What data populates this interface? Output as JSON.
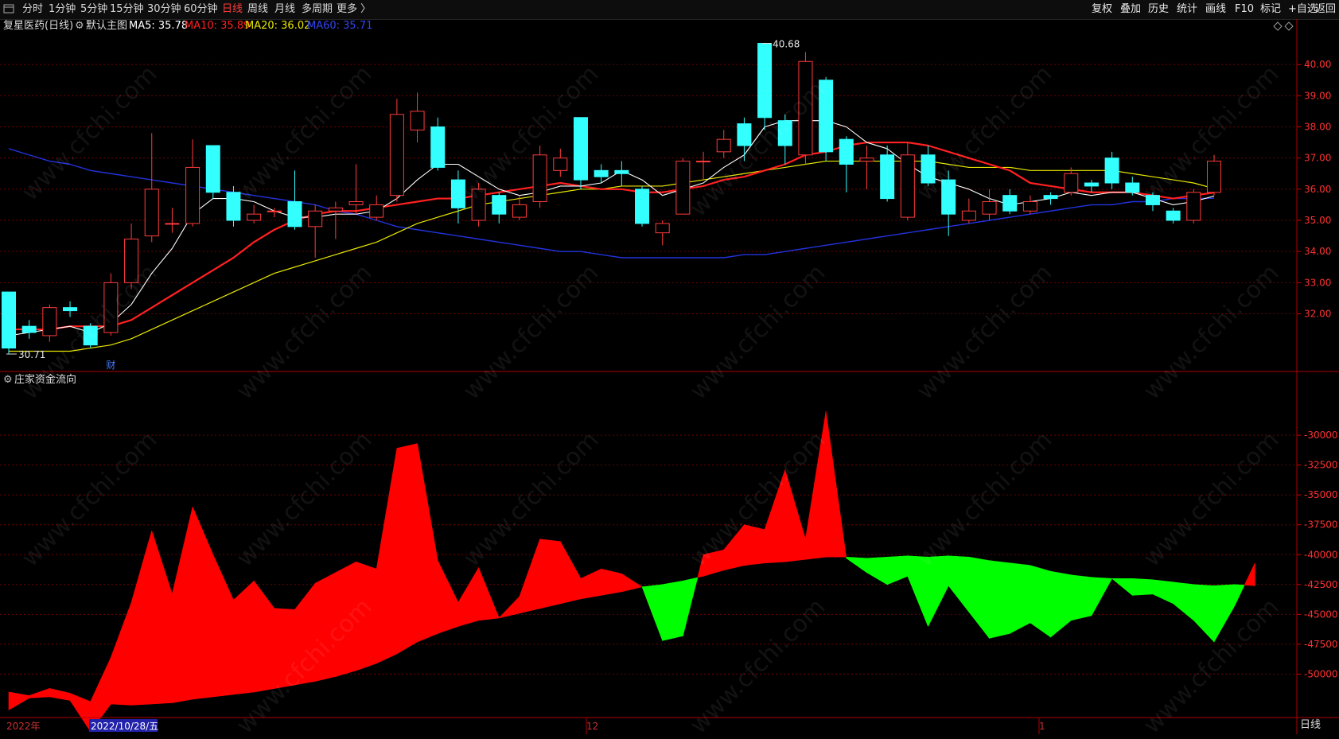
{
  "toolbar": {
    "periods": [
      "分时",
      "1分钟",
      "5分钟",
      "15分钟",
      "30分钟",
      "60分钟",
      "日线",
      "周线",
      "月线",
      "多周期",
      "更多 〉"
    ],
    "active_period": "日线",
    "right_buttons": [
      "复权",
      "叠加",
      "历史",
      "统计",
      "画线",
      "F10",
      "标记",
      "+自选",
      "返回"
    ]
  },
  "info": {
    "stock": "复星医药(日线)",
    "main_chart": "默认主图",
    "ma5": "MA5: 35.78",
    "ma10": "MA10: 35.89",
    "ma20": "MA20: 36.02",
    "ma60": "MA60: 35.71"
  },
  "colors": {
    "up": "#ff3b3b",
    "down": "#33ffff",
    "ma5": "#ffffff",
    "ma10": "#ff2020",
    "ma20": "#e8e800",
    "ma60": "#2233dd",
    "flow_up": "#ff0000",
    "flow_down": "#00ff00",
    "grid": "#6e0000",
    "axis_text": "#ff3030"
  },
  "indicator": {
    "title": "庄家资金流向"
  },
  "annotations": {
    "high": "40.68",
    "low": "30.71",
    "finance_marker": "财"
  },
  "x_labels": {
    "start": "2022年",
    "selected": "2022/10/28/五",
    "dec": "12",
    "jan": "1"
  },
  "period_tag": "日线",
  "chart_data": {
    "type": "candlestick",
    "price_axis": {
      "ticks": [
        32,
        33,
        34,
        35,
        36,
        37,
        38,
        39,
        40
      ],
      "labels": [
        "32.00",
        "33.00",
        "34.00",
        "35.00",
        "36.00",
        "37.00",
        "38.00",
        "39.00",
        "40.00"
      ],
      "range": [
        30.2,
        41.0
      ]
    },
    "flow_axis": {
      "ticks": [
        -30000,
        -32500,
        -35000,
        -37500,
        -40000,
        -42500,
        -45000,
        -47500,
        -50000
      ],
      "labels": [
        "-30000",
        "-32500",
        "-35000",
        "-37500",
        "-40000",
        "-42500",
        "-45000",
        "-47500",
        "-50000"
      ],
      "range": [
        -53500,
        -26000
      ]
    },
    "candles": [
      {
        "o": 32.7,
        "c": 30.9,
        "h": 32.7,
        "l": 30.71
      },
      {
        "o": 31.6,
        "c": 31.4,
        "h": 31.8,
        "l": 31.2
      },
      {
        "o": 31.3,
        "c": 32.2,
        "h": 32.3,
        "l": 31.1
      },
      {
        "o": 32.2,
        "c": 32.1,
        "h": 32.4,
        "l": 31.9
      },
      {
        "o": 31.6,
        "c": 31.0,
        "h": 31.7,
        "l": 30.9
      },
      {
        "o": 31.4,
        "c": 33.0,
        "h": 33.3,
        "l": 31.3
      },
      {
        "o": 33.0,
        "c": 34.4,
        "h": 34.9,
        "l": 32.8
      },
      {
        "o": 34.5,
        "c": 36.0,
        "h": 37.8,
        "l": 34.3
      },
      {
        "o": 34.9,
        "c": 34.9,
        "h": 35.4,
        "l": 34.6
      },
      {
        "o": 34.9,
        "c": 36.7,
        "h": 37.6,
        "l": 34.8
      },
      {
        "o": 37.4,
        "c": 35.9,
        "h": 37.4,
        "l": 35.7
      },
      {
        "o": 35.9,
        "c": 35.0,
        "h": 36.1,
        "l": 34.8
      },
      {
        "o": 35.0,
        "c": 35.2,
        "h": 35.5,
        "l": 34.9
      },
      {
        "o": 35.3,
        "c": 35.3,
        "h": 35.4,
        "l": 35.1
      },
      {
        "o": 35.6,
        "c": 34.8,
        "h": 36.6,
        "l": 34.7
      },
      {
        "o": 34.8,
        "c": 35.3,
        "h": 35.5,
        "l": 33.8
      },
      {
        "o": 35.3,
        "c": 35.4,
        "h": 35.6,
        "l": 34.4
      },
      {
        "o": 35.5,
        "c": 35.6,
        "h": 36.8,
        "l": 35.2
      },
      {
        "o": 35.1,
        "c": 35.5,
        "h": 35.8,
        "l": 35.0
      },
      {
        "o": 35.8,
        "c": 38.4,
        "h": 38.9,
        "l": 35.6
      },
      {
        "o": 37.9,
        "c": 38.5,
        "h": 39.1,
        "l": 37.5
      },
      {
        "o": 38.0,
        "c": 36.7,
        "h": 38.3,
        "l": 36.6
      },
      {
        "o": 36.3,
        "c": 35.4,
        "h": 36.6,
        "l": 34.9
      },
      {
        "o": 35.0,
        "c": 36.0,
        "h": 36.2,
        "l": 34.8
      },
      {
        "o": 35.8,
        "c": 35.2,
        "h": 35.9,
        "l": 34.9
      },
      {
        "o": 35.1,
        "c": 35.5,
        "h": 35.8,
        "l": 35.0
      },
      {
        "o": 35.6,
        "c": 37.1,
        "h": 37.4,
        "l": 35.4
      },
      {
        "o": 36.6,
        "c": 37.0,
        "h": 37.3,
        "l": 36.4
      },
      {
        "o": 38.3,
        "c": 36.3,
        "h": 38.3,
        "l": 36.0
      },
      {
        "o": 36.6,
        "c": 36.4,
        "h": 36.8,
        "l": 36.2
      },
      {
        "o": 36.6,
        "c": 36.5,
        "h": 36.9,
        "l": 36.1
      },
      {
        "o": 36.0,
        "c": 34.9,
        "h": 36.1,
        "l": 34.8
      },
      {
        "o": 34.6,
        "c": 34.9,
        "h": 35.0,
        "l": 34.2
      },
      {
        "o": 35.2,
        "c": 36.9,
        "h": 37.0,
        "l": 35.2
      },
      {
        "o": 36.9,
        "c": 36.9,
        "h": 37.2,
        "l": 36.3
      },
      {
        "o": 37.2,
        "c": 37.6,
        "h": 37.9,
        "l": 37.0
      },
      {
        "o": 38.1,
        "c": 37.4,
        "h": 38.3,
        "l": 36.9
      },
      {
        "o": 40.68,
        "c": 38.3,
        "h": 40.68,
        "l": 37.9
      },
      {
        "o": 38.2,
        "c": 37.4,
        "h": 38.4,
        "l": 36.8
      },
      {
        "o": 37.1,
        "c": 40.1,
        "h": 40.4,
        "l": 36.8
      },
      {
        "o": 39.5,
        "c": 37.2,
        "h": 39.6,
        "l": 36.9
      },
      {
        "o": 37.6,
        "c": 36.8,
        "h": 37.7,
        "l": 35.9
      },
      {
        "o": 36.9,
        "c": 37.0,
        "h": 37.4,
        "l": 36.0
      },
      {
        "o": 37.1,
        "c": 35.7,
        "h": 37.4,
        "l": 35.6
      },
      {
        "o": 35.1,
        "c": 37.1,
        "h": 37.5,
        "l": 35.0
      },
      {
        "o": 37.1,
        "c": 36.2,
        "h": 37.4,
        "l": 36.1
      },
      {
        "o": 36.3,
        "c": 35.2,
        "h": 36.6,
        "l": 34.5
      },
      {
        "o": 35.0,
        "c": 35.3,
        "h": 35.7,
        "l": 34.9
      },
      {
        "o": 35.2,
        "c": 35.6,
        "h": 36.0,
        "l": 35.0
      },
      {
        "o": 35.8,
        "c": 35.3,
        "h": 36.0,
        "l": 35.2
      },
      {
        "o": 35.3,
        "c": 35.6,
        "h": 35.8,
        "l": 35.2
      },
      {
        "o": 35.8,
        "c": 35.7,
        "h": 35.9,
        "l": 35.5
      },
      {
        "o": 35.9,
        "c": 36.5,
        "h": 36.7,
        "l": 35.8
      },
      {
        "o": 36.2,
        "c": 36.1,
        "h": 36.3,
        "l": 35.9
      },
      {
        "o": 37.0,
        "c": 36.2,
        "h": 37.2,
        "l": 36.0
      },
      {
        "o": 36.2,
        "c": 35.9,
        "h": 36.4,
        "l": 35.8
      },
      {
        "o": 35.8,
        "c": 35.5,
        "h": 35.9,
        "l": 35.3
      },
      {
        "o": 35.3,
        "c": 35.0,
        "h": 35.4,
        "l": 34.9
      },
      {
        "o": 35.0,
        "c": 35.9,
        "h": 36.0,
        "l": 34.9
      },
      {
        "o": 35.9,
        "c": 36.9,
        "h": 37.1,
        "l": 35.8
      }
    ],
    "ma5": [
      31.3,
      31.4,
      31.5,
      31.6,
      31.4,
      31.7,
      32.3,
      33.3,
      34.1,
      35.2,
      35.7,
      35.7,
      35.6,
      35.3,
      35.1,
      35.1,
      35.2,
      35.2,
      35.3,
      35.7,
      36.3,
      36.8,
      36.8,
      36.4,
      36.0,
      35.8,
      35.9,
      36.1,
      36.1,
      36.2,
      36.6,
      36.3,
      35.8,
      36.0,
      36.2,
      36.7,
      37.1,
      38.0,
      38.2,
      38.2,
      38.2,
      38.0,
      37.5,
      37.3,
      36.8,
      36.4,
      36.2,
      36.0,
      35.7,
      35.5,
      35.6,
      35.7,
      35.9,
      35.8,
      35.9,
      35.9,
      35.7,
      35.5,
      35.6,
      35.78
    ],
    "ma10": [
      31.5,
      31.5,
      31.5,
      31.6,
      31.6,
      31.6,
      31.8,
      32.2,
      32.6,
      33.0,
      33.4,
      33.8,
      34.3,
      34.7,
      35.0,
      35.2,
      35.3,
      35.3,
      35.4,
      35.5,
      35.6,
      35.7,
      35.7,
      35.8,
      35.9,
      36.0,
      36.1,
      36.2,
      36.1,
      36.0,
      36.0,
      35.9,
      35.9,
      36.0,
      36.1,
      36.3,
      36.4,
      36.6,
      36.8,
      37.1,
      37.2,
      37.4,
      37.5,
      37.5,
      37.5,
      37.4,
      37.2,
      37.0,
      36.8,
      36.6,
      36.2,
      36.1,
      36.0,
      35.9,
      35.9,
      35.9,
      35.8,
      35.7,
      35.8,
      35.89
    ],
    "ma20": [
      30.8,
      30.8,
      30.8,
      30.8,
      30.9,
      31.0,
      31.2,
      31.5,
      31.8,
      32.1,
      32.4,
      32.7,
      33.0,
      33.3,
      33.5,
      33.7,
      33.9,
      34.1,
      34.3,
      34.6,
      34.9,
      35.1,
      35.3,
      35.5,
      35.6,
      35.7,
      35.8,
      35.9,
      36.0,
      36.0,
      36.1,
      36.1,
      36.1,
      36.2,
      36.3,
      36.4,
      36.5,
      36.6,
      36.7,
      36.8,
      36.9,
      36.9,
      36.9,
      36.9,
      36.9,
      36.9,
      36.8,
      36.7,
      36.7,
      36.7,
      36.6,
      36.6,
      36.6,
      36.6,
      36.6,
      36.5,
      36.4,
      36.3,
      36.2,
      36.02
    ],
    "ma60": [
      37.3,
      37.1,
      36.9,
      36.8,
      36.6,
      36.5,
      36.4,
      36.3,
      36.2,
      36.1,
      36.0,
      35.9,
      35.8,
      35.7,
      35.6,
      35.5,
      35.3,
      35.2,
      35.0,
      34.8,
      34.7,
      34.6,
      34.5,
      34.4,
      34.3,
      34.2,
      34.1,
      34.0,
      34.0,
      33.9,
      33.8,
      33.8,
      33.8,
      33.8,
      33.8,
      33.8,
      33.9,
      33.9,
      34.0,
      34.1,
      34.2,
      34.3,
      34.4,
      34.5,
      34.6,
      34.7,
      34.8,
      34.9,
      35.0,
      35.1,
      35.2,
      35.3,
      35.4,
      35.5,
      35.5,
      35.6,
      35.6,
      35.7,
      35.7,
      35.71
    ],
    "flow": [
      {
        "line": -51500,
        "ref": -53000
      },
      {
        "line": -51800,
        "ref": -52000
      },
      {
        "line": -51200,
        "ref": -51900
      },
      {
        "line": -51600,
        "ref": -52200
      },
      {
        "line": -52300,
        "ref": -54800
      },
      {
        "line": -48600,
        "ref": -52500
      },
      {
        "line": -44000,
        "ref": -52600
      },
      {
        "line": -38000,
        "ref": -52500
      },
      {
        "line": -43300,
        "ref": -52400
      },
      {
        "line": -36000,
        "ref": -52100
      },
      {
        "line": -40000,
        "ref": -51900
      },
      {
        "line": -43800,
        "ref": -51700
      },
      {
        "line": -42200,
        "ref": -51500
      },
      {
        "line": -44500,
        "ref": -51200
      },
      {
        "line": -44600,
        "ref": -50900
      },
      {
        "line": -42400,
        "ref": -50600
      },
      {
        "line": -41500,
        "ref": -50200
      },
      {
        "line": -40600,
        "ref": -49700
      },
      {
        "line": -41200,
        "ref": -49100
      },
      {
        "line": -31100,
        "ref": -48300
      },
      {
        "line": -30700,
        "ref": -47300
      },
      {
        "line": -40500,
        "ref": -46600
      },
      {
        "line": -44000,
        "ref": -46000
      },
      {
        "line": -41100,
        "ref": -45500
      },
      {
        "line": -45300,
        "ref": -45300
      },
      {
        "line": -43500,
        "ref": -44900
      },
      {
        "line": -38700,
        "ref": -44500
      },
      {
        "line": -38900,
        "ref": -44100
      },
      {
        "line": -42000,
        "ref": -43700
      },
      {
        "line": -41200,
        "ref": -43400
      },
      {
        "line": -41600,
        "ref": -43100
      },
      {
        "line": -42700,
        "ref": -42700
      },
      {
        "line": -47200,
        "ref": -42500
      },
      {
        "line": -46800,
        "ref": -42200
      },
      {
        "line": -40000,
        "ref": -41800
      },
      {
        "line": -39600,
        "ref": -41300
      },
      {
        "line": -37500,
        "ref": -40900
      },
      {
        "line": -37900,
        "ref": -40700
      },
      {
        "line": -32900,
        "ref": -40600
      },
      {
        "line": -38700,
        "ref": -40400
      },
      {
        "line": -28000,
        "ref": -40200
      },
      {
        "line": -40300,
        "ref": -40200
      },
      {
        "line": -41500,
        "ref": -40300
      },
      {
        "line": -42500,
        "ref": -40200
      },
      {
        "line": -41800,
        "ref": -40100
      },
      {
        "line": -46000,
        "ref": -40200
      },
      {
        "line": -42600,
        "ref": -40100
      },
      {
        "line": -44800,
        "ref": -40200
      },
      {
        "line": -47000,
        "ref": -40500
      },
      {
        "line": -46600,
        "ref": -40700
      },
      {
        "line": -45700,
        "ref": -40900
      },
      {
        "line": -46900,
        "ref": -41400
      },
      {
        "line": -45500,
        "ref": -41700
      },
      {
        "line": -45100,
        "ref": -41900
      },
      {
        "line": -42000,
        "ref": -42000
      },
      {
        "line": -43400,
        "ref": -42000
      },
      {
        "line": -43300,
        "ref": -42100
      },
      {
        "line": -44100,
        "ref": -42300
      },
      {
        "line": -45500,
        "ref": -42500
      },
      {
        "line": -47300,
        "ref": -42600
      },
      {
        "line": -44300,
        "ref": -42500
      },
      {
        "line": -40700,
        "ref": -42600
      }
    ]
  }
}
